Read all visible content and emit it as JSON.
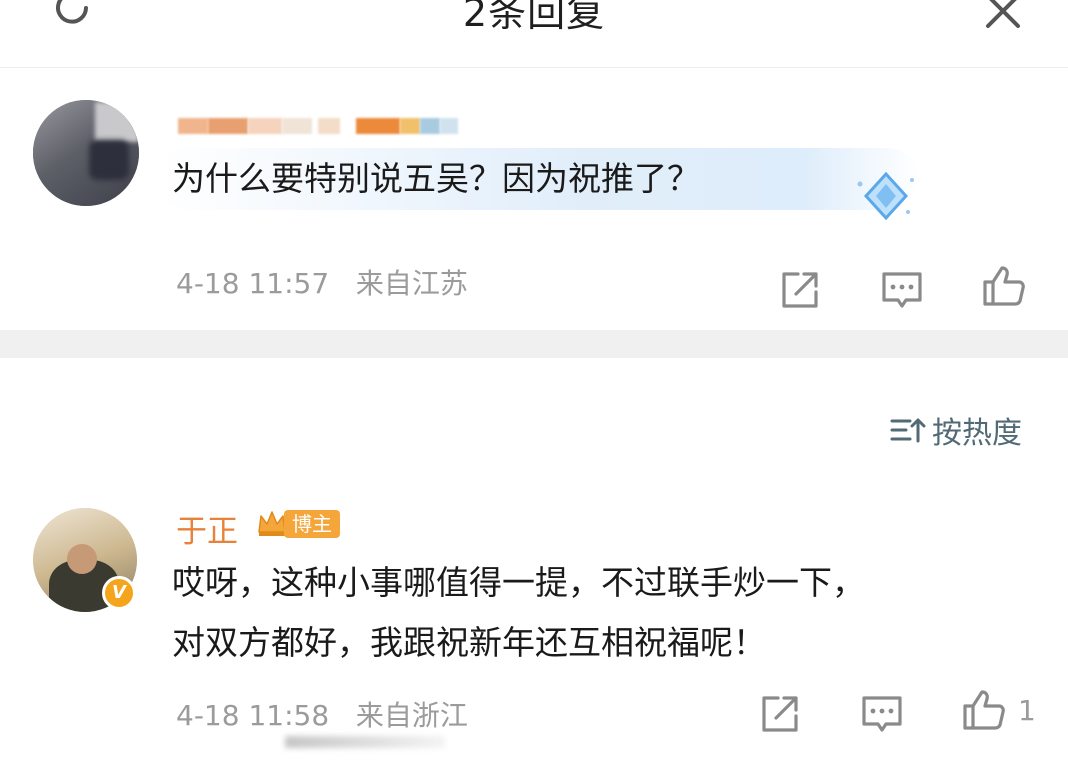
{
  "header": {
    "title": "2条回复",
    "refresh_icon": "refresh-icon",
    "close_icon": "close-icon"
  },
  "comments": [
    {
      "text": "为什么要特别说五吴？因为祝推了？",
      "time": "4-18 11:57",
      "location": "来自江苏",
      "actions": [
        "share-icon",
        "comment-icon",
        "like-icon"
      ]
    },
    {
      "author": "于正",
      "role_badge": "博主",
      "text_line1": "哎呀，这种小事哪值得一提，不过联手炒一下，",
      "text_line2": "对双方都好，我跟祝新年还互相祝福呢！",
      "time": "4-18 11:58",
      "location": "来自浙江",
      "actions": [
        "share-icon",
        "comment-icon",
        "like-icon"
      ],
      "like_count": "1"
    }
  ],
  "sort": {
    "label": "按热度",
    "icon": "sort-icon"
  },
  "colors": {
    "author_name": "#e9813a",
    "badge": "#f4a63b",
    "meta_text": "#9b9b9b",
    "sort_text": "#526a76",
    "divider": "#f0f0f0"
  }
}
